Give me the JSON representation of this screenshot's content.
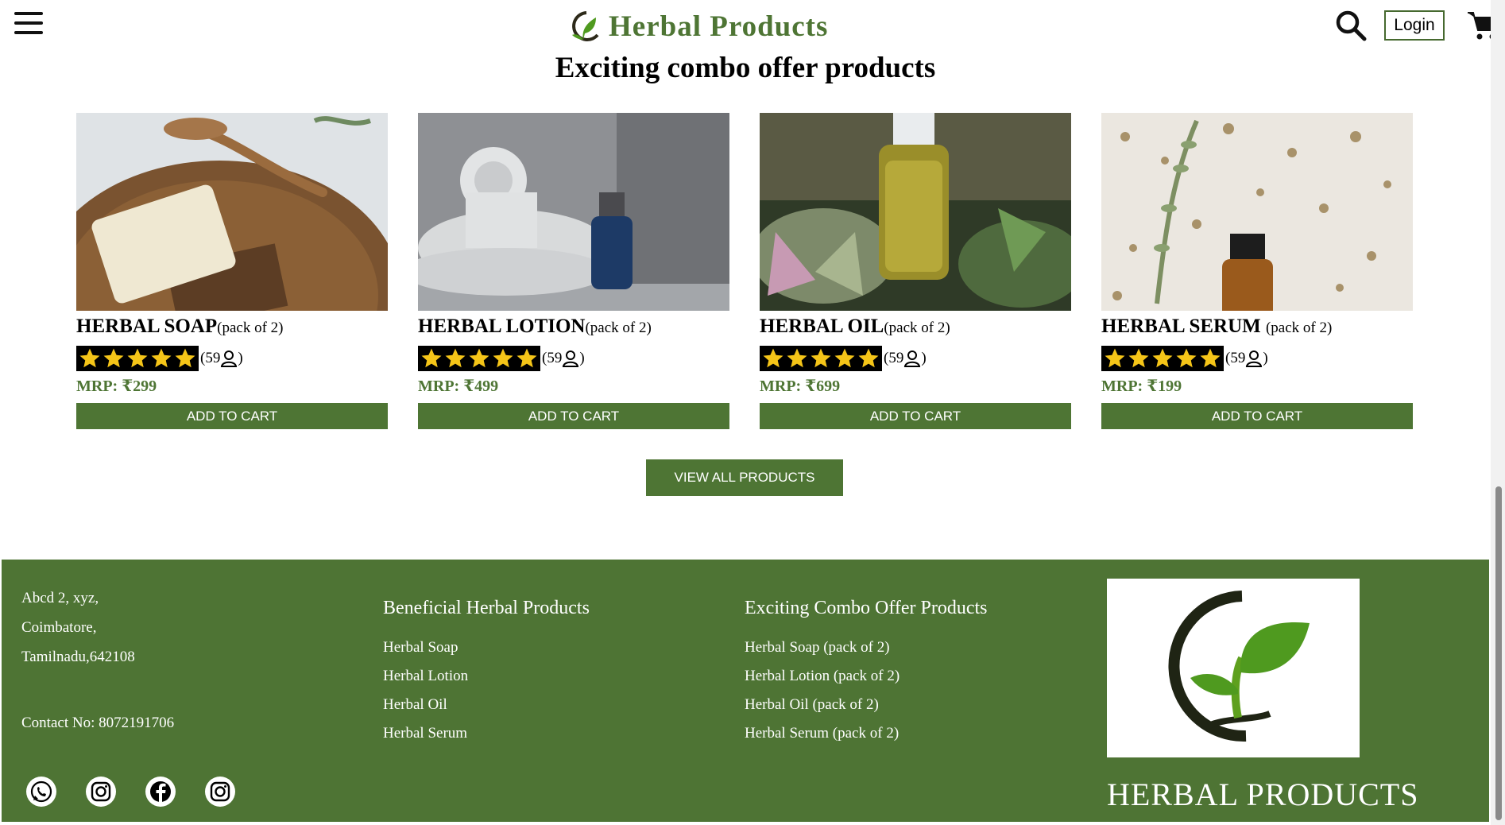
{
  "header": {
    "brand_title": "Herbal Products",
    "login_label": "Login"
  },
  "section": {
    "title": "Exciting combo offer products"
  },
  "products": [
    {
      "name": "HERBAL SOAP",
      "pack": "(pack of 2)",
      "rating": 5,
      "reviews": "(59",
      "reviews_close": ")",
      "price": "MRP: ₹299",
      "button": "ADD TO CART"
    },
    {
      "name": "HERBAL LOTION",
      "pack": "(pack of 2)",
      "rating": 5,
      "reviews": "(59",
      "reviews_close": ")",
      "price": "MRP: ₹499",
      "button": "ADD TO CART"
    },
    {
      "name": "HERBAL OIL",
      "pack": "(pack of 2)",
      "rating": 5,
      "reviews": "(59",
      "reviews_close": ")",
      "price": "MRP: ₹699",
      "button": "ADD TO CART"
    },
    {
      "name": "HERBAL SERUM ",
      "pack": "(pack of 2)",
      "rating": 5,
      "reviews": "(59",
      "reviews_close": ")",
      "price": "MRP: ₹199",
      "button": "ADD TO CART"
    }
  ],
  "view_all_label": "VIEW ALL PRODUCTS",
  "footer": {
    "address_line1": "Abcd 2, xyz,",
    "address_line2": "Coimbatore,",
    "address_line3": "Tamilnadu,642108",
    "contact": "Contact No: 8072191706",
    "col1_title": "Beneficial Herbal Products",
    "col1_links": [
      "Herbal Soap",
      "Herbal Lotion",
      "Herbal Oil",
      "Herbal Serum"
    ],
    "col2_title": "Exciting Combo Offer Products",
    "col2_links": [
      "Herbal Soap (pack of 2)",
      "Herbal Lotion (pack of 2)",
      "Herbal Oil (pack of 2)",
      "Herbal Serum (pack of 2)"
    ],
    "social_icons": [
      "whatsapp-icon",
      "instagram-icon",
      "facebook-icon",
      "instagram-icon"
    ],
    "brand_name": "HERBAL PRODUCTS"
  },
  "colors": {
    "brand_green": "#4e7534",
    "star_yellow": "#f5c518"
  }
}
